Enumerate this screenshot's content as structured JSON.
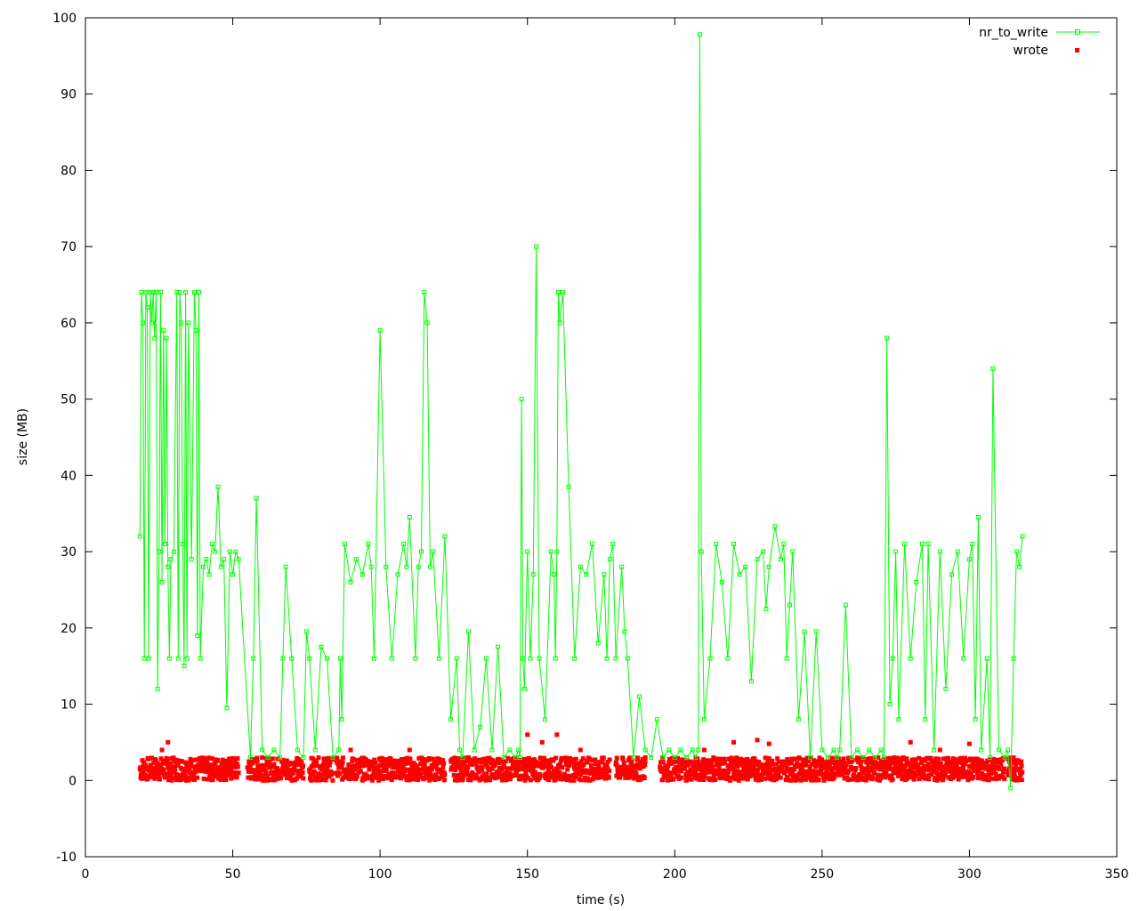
{
  "chart_data": {
    "type": "line",
    "title": "",
    "xlabel": "time (s)",
    "ylabel": "size (MB)",
    "xlim": [
      0,
      350
    ],
    "ylim": [
      -10,
      100
    ],
    "x_ticks": [
      0,
      50,
      100,
      150,
      200,
      250,
      300,
      350
    ],
    "y_ticks": [
      -10,
      0,
      10,
      20,
      30,
      40,
      50,
      60,
      70,
      80,
      90,
      100
    ],
    "grid": false,
    "legend": "top-right",
    "series": [
      {
        "name": "nr_to_write",
        "style": "line+open-square-markers",
        "color": "#00ff00",
        "x": [
          18.5,
          19,
          19.5,
          20,
          20.5,
          21,
          21.5,
          22,
          22.5,
          23,
          23.5,
          24,
          24.5,
          25,
          25.5,
          26,
          26.5,
          27,
          27.5,
          28,
          28.5,
          29,
          30,
          31,
          31.5,
          32,
          32.5,
          33,
          33.5,
          34,
          34.5,
          35,
          36,
          37,
          37.5,
          38,
          38.5,
          39,
          40,
          41,
          42,
          43,
          44,
          45,
          46,
          47,
          48,
          49,
          50,
          51,
          52,
          56,
          57,
          58,
          60,
          62,
          64,
          66,
          67,
          68,
          70,
          72,
          74,
          75,
          76,
          78,
          80,
          82,
          84,
          86,
          86.5,
          87,
          88,
          90,
          92,
          94,
          96,
          97,
          98,
          100,
          102,
          104,
          106,
          108,
          109,
          110,
          112,
          113,
          114,
          115,
          116,
          117,
          118,
          120,
          122,
          124,
          126,
          127,
          128,
          130,
          132,
          134,
          136,
          138,
          140,
          142,
          144,
          146,
          147,
          147.5,
          148,
          148.5,
          149,
          150,
          151,
          152,
          153,
          154,
          156,
          158,
          159,
          159.5,
          160,
          160.5,
          161,
          162,
          164,
          166,
          168,
          170,
          172,
          174,
          176,
          177,
          178,
          179,
          180,
          182,
          183,
          184,
          186,
          188,
          190,
          192,
          194,
          196,
          198,
          200,
          202,
          204,
          206,
          207,
          208,
          208.5,
          209,
          210,
          212,
          214,
          216,
          218,
          220,
          222,
          224,
          226,
          228,
          230,
          231,
          232,
          234,
          236,
          237,
          238,
          239,
          240,
          242,
          244,
          246,
          248,
          250,
          252,
          254,
          255,
          256,
          258,
          260,
          262,
          264,
          266,
          268,
          270,
          271,
          272,
          273,
          274,
          275,
          276,
          278,
          280,
          282,
          284,
          285,
          286,
          288,
          290,
          292,
          294,
          296,
          298,
          300,
          301,
          302,
          303,
          304,
          306,
          307,
          308,
          310,
          312,
          313,
          314,
          315,
          316,
          317,
          318
        ],
        "y": [
          32,
          64,
          60,
          16,
          64,
          62,
          16,
          64,
          60,
          64,
          58,
          64,
          12,
          30,
          64,
          26,
          59,
          31,
          58,
          28,
          16,
          29,
          30,
          64,
          16,
          64,
          60,
          31,
          15,
          64,
          16,
          60,
          29,
          64,
          59,
          19,
          64,
          16,
          28,
          29,
          27,
          31,
          30,
          38.5,
          28,
          29,
          9.5,
          30,
          27,
          30,
          29,
          3,
          16,
          37,
          4,
          3,
          4,
          3,
          16,
          28,
          16,
          4,
          3,
          19.5,
          16,
          4,
          17.5,
          16,
          3,
          4,
          16,
          8,
          31,
          26,
          29,
          27,
          31,
          28,
          16,
          59,
          28,
          16,
          27,
          31,
          28,
          34.5,
          16,
          28,
          30,
          64,
          60,
          28,
          30,
          16,
          32,
          8,
          16,
          4,
          3,
          19.5,
          4,
          7,
          16,
          4,
          17.5,
          3,
          4,
          3,
          4,
          3,
          50,
          16,
          12,
          30,
          16,
          27,
          70,
          16,
          8,
          30,
          27,
          16,
          30,
          64,
          60,
          64,
          38.5,
          16,
          28,
          27,
          31,
          18,
          27,
          16,
          29,
          31,
          16,
          28,
          19.5,
          16,
          3,
          11,
          4,
          3,
          8,
          3,
          4,
          3,
          4,
          3,
          4,
          3,
          4,
          97.8,
          30,
          8,
          16,
          31,
          26,
          16,
          31,
          27,
          28,
          13,
          29,
          30,
          22.5,
          28,
          33.3,
          29,
          31,
          16,
          23,
          30,
          8,
          19.5,
          3,
          19.5,
          4,
          3,
          4,
          3,
          4,
          23,
          3,
          4,
          3,
          4,
          3,
          4,
          3,
          58,
          10,
          16,
          30,
          8,
          31,
          16,
          26,
          31,
          8,
          31,
          4,
          30,
          12,
          27,
          30,
          16,
          29,
          31,
          8,
          34.5,
          4,
          16,
          3,
          54,
          4,
          3,
          4,
          -1,
          16,
          30,
          28,
          32
        ]
      },
      {
        "name": "wrote",
        "style": "filled-square-markers",
        "color": "#ff0000",
        "ranges": [
          [
            18.5,
            52
          ],
          [
            55,
            74
          ],
          [
            76,
            84
          ],
          [
            85,
            122
          ],
          [
            124,
            178
          ],
          [
            180,
            190
          ],
          [
            195,
            312
          ],
          [
            313,
            318
          ]
        ],
        "typical_max": 3,
        "outliers": [
          [
            26,
            4
          ],
          [
            28,
            5
          ],
          [
            57,
            2.5
          ],
          [
            60,
            3
          ],
          [
            90,
            4
          ],
          [
            110,
            4
          ],
          [
            130,
            3
          ],
          [
            150,
            6
          ],
          [
            155,
            5
          ],
          [
            160,
            6
          ],
          [
            168,
            4
          ],
          [
            190,
            3
          ],
          [
            210,
            4
          ],
          [
            220,
            5
          ],
          [
            228,
            5.3
          ],
          [
            232,
            4.8
          ],
          [
            280,
            5
          ],
          [
            290,
            4
          ],
          [
            300,
            4.8
          ],
          [
            315,
            3
          ]
        ]
      }
    ]
  }
}
